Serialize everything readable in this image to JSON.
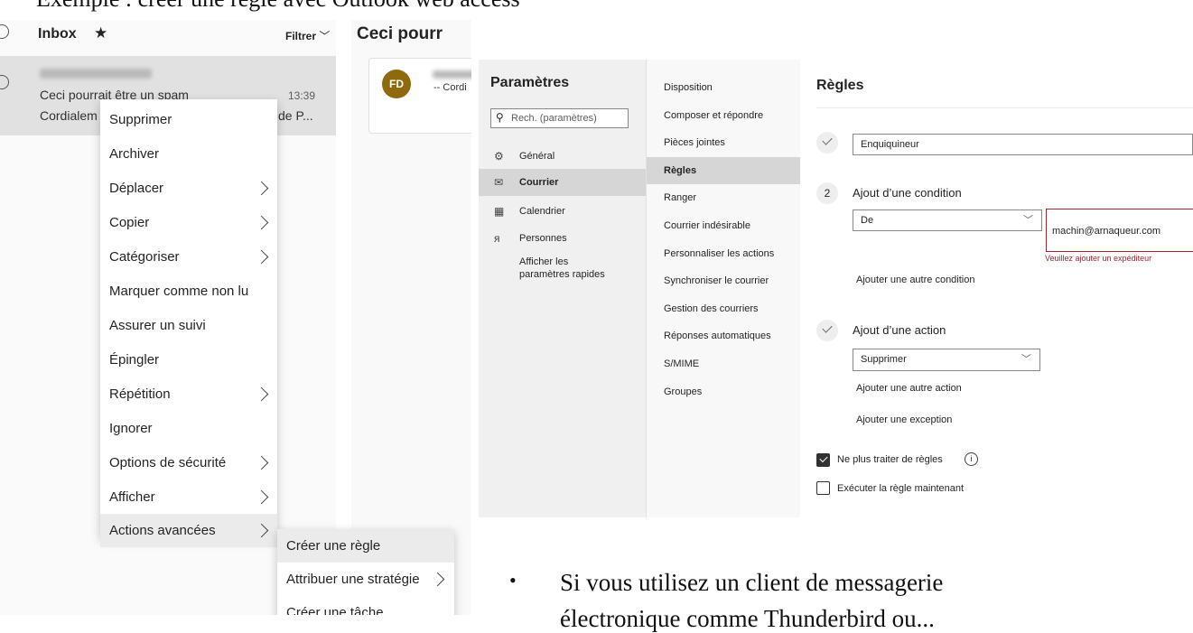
{
  "doc": {
    "header_line": "Exemple : créer une règle avec Outlook web access",
    "bullet": "•",
    "bullet_text": "Si vous utilisez un client de messagerie",
    "bullet_text_cont": "électronique comme Thunderbird ou..."
  },
  "outlook": {
    "folder": "Inbox",
    "star_icon": "star-icon",
    "filter_label": "Filtrer",
    "reading_title": "Ceci pourr",
    "message": {
      "subject": "Ceci pourrait être un spam",
      "preview": "Cordialem",
      "preview_tail": "de P...",
      "time": "13:39"
    },
    "reading": {
      "avatar_initials": "FD",
      "avatar_color": "#8e6a0d",
      "preview": "-- Cordi"
    },
    "context_menu": [
      {
        "label": "Supprimer",
        "submenu": false
      },
      {
        "label": "Archiver",
        "submenu": false
      },
      {
        "label": "Déplacer",
        "submenu": true
      },
      {
        "label": "Copier",
        "submenu": true
      },
      {
        "label": "Catégoriser",
        "submenu": true
      },
      {
        "label": "Marquer comme non lu",
        "submenu": false
      },
      {
        "label": "Assurer un suivi",
        "submenu": false
      },
      {
        "label": "Épingler",
        "submenu": false
      },
      {
        "label": "Répétition",
        "submenu": true
      },
      {
        "label": "Ignorer",
        "submenu": false
      },
      {
        "label": "Options de sécurité",
        "submenu": true
      },
      {
        "label": "Afficher",
        "submenu": true
      },
      {
        "label": "Actions avancées",
        "submenu": true,
        "highlighted": true
      }
    ],
    "submenu": [
      {
        "label": "Créer une règle",
        "highlighted": true
      },
      {
        "label": "Attribuer une stratégie",
        "submenu": true
      },
      {
        "label": "Créer une tâche"
      }
    ]
  },
  "settings": {
    "title": "Paramètres",
    "search_placeholder": "Rech. (paramètres)",
    "nav": [
      {
        "label": "Général",
        "icon": "gear-icon"
      },
      {
        "label": "Courrier",
        "icon": "mail-icon",
        "selected": true
      },
      {
        "label": "Calendrier",
        "icon": "calendar-icon"
      },
      {
        "label": "Personnes",
        "icon": "people-icon"
      },
      {
        "label": "Afficher les",
        "icon": ""
      },
      {
        "label": "paramètres rapides",
        "icon": ""
      }
    ],
    "subnav": [
      {
        "label": "Disposition"
      },
      {
        "label": "Composer et répondre"
      },
      {
        "label": "Pièces jointes"
      },
      {
        "label": "Règles",
        "selected": true
      },
      {
        "label": "Ranger"
      },
      {
        "label": "Courrier indésirable"
      },
      {
        "label": "Personnaliser les actions"
      },
      {
        "label": "Synchroniser le courrier"
      },
      {
        "label": "Gestion des courriers"
      },
      {
        "label": "Réponses automatiques"
      },
      {
        "label": "S/MIME"
      },
      {
        "label": "Groupes"
      }
    ],
    "rules": {
      "title": "Règles",
      "name_value": "Enquiquineur",
      "step2_number": "2",
      "condition_title": "Ajout d’une condition",
      "condition_select": "De",
      "condition_value": "machin@arnaqueur.com",
      "error_text": "Veuillez ajouter un expéditeur",
      "add_condition": "Ajouter une autre condition",
      "action_title": "Ajout d’une action",
      "action_select": "Supprimer",
      "add_action": "Ajouter une autre action",
      "add_exception": "Ajouter une exception",
      "stop_rules_label": "Ne plus traiter de règles",
      "stop_rules_checked": true,
      "run_now_label": "Exécuter la règle maintenant",
      "run_now_checked": false,
      "error_color": "#a4262c"
    }
  }
}
